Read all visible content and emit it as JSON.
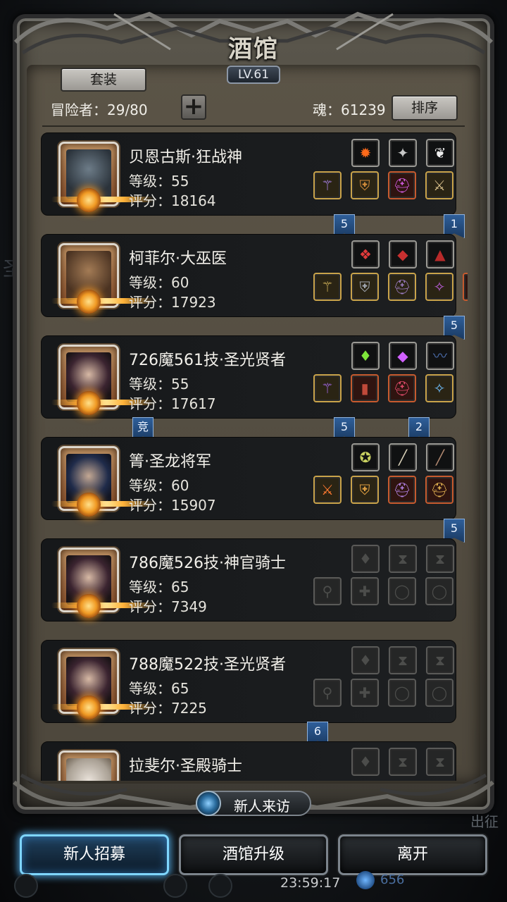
{
  "title": "酒馆",
  "level_badge": "LV.61",
  "header": {
    "suit_button": "套装",
    "adventurer_label": "冒险者：29/80",
    "add_button": "+",
    "soul_label": "魂：61239",
    "sort_button": "排序"
  },
  "heroes": [
    {
      "name": "贝恩古斯·狂战神",
      "level": "等级：55",
      "score": "评分：18164",
      "portrait": "berserker-portrait",
      "top_slots": [
        {
          "icon": "fire-orb",
          "glyph": "✹",
          "color": "#ff6a1a"
        },
        {
          "icon": "crest",
          "glyph": "✦",
          "color": "#c7c7c7"
        },
        {
          "icon": "wing",
          "glyph": "❦",
          "color": "#eeeeee"
        }
      ],
      "bottom_slots": [
        {
          "icon": "staff",
          "glyph": "⚚",
          "color": "#b58bff",
          "frame": "gold"
        },
        {
          "icon": "armor",
          "glyph": "⛨",
          "color": "#d08a3a",
          "frame": "gold"
        },
        {
          "icon": "helm",
          "glyph": "⛑",
          "color": "#d05adf",
          "frame": "red"
        },
        {
          "icon": "sword",
          "glyph": "⚔",
          "color": "#d8c08a",
          "frame": "gold"
        }
      ],
      "tags": [
        {
          "text": "5"
        },
        {
          "text": "1"
        }
      ]
    },
    {
      "name": "柯菲尔·大巫医",
      "level": "等级：60",
      "score": "评分：17923",
      "portrait": "shaman-portrait",
      "top_slots": [
        {
          "icon": "red-gem",
          "glyph": "❖",
          "color": "#e03a3a"
        },
        {
          "icon": "red-boot",
          "glyph": "◆",
          "color": "#c83030"
        },
        {
          "icon": "red-hat",
          "glyph": "▲",
          "color": "#b82a2a"
        }
      ],
      "bottom_slots": [
        {
          "icon": "gold-staff",
          "glyph": "⚚",
          "color": "#e0c060",
          "frame": "gold"
        },
        {
          "icon": "shield",
          "glyph": "⛨",
          "color": "#a0a6b0",
          "frame": "gold"
        },
        {
          "icon": "dark-helm",
          "glyph": "⛑",
          "color": "#9a7bc0",
          "frame": "gold"
        },
        {
          "icon": "amulet",
          "glyph": "✧",
          "color": "#c060e0",
          "frame": "gold"
        },
        {
          "icon": "crown",
          "glyph": "♛",
          "color": "#d85050",
          "frame": "red"
        }
      ],
      "tags": [
        {
          "text": "5"
        }
      ]
    },
    {
      "name": "726魔561技·圣光贤者",
      "level": "等级：55",
      "score": "评分：17617",
      "portrait": "sage-portrait",
      "top_slots": [
        {
          "icon": "green-crystal",
          "glyph": "♦",
          "color": "#7ee63a"
        },
        {
          "icon": "purple-crystal",
          "glyph": "◆",
          "color": "#d060ff"
        },
        {
          "icon": "dark-whip",
          "glyph": "〰",
          "color": "#4a6aa8"
        }
      ],
      "bottom_slots": [
        {
          "icon": "purple-staff",
          "glyph": "⚚",
          "color": "#b070ff",
          "frame": "gold"
        },
        {
          "icon": "cloak",
          "glyph": "▮",
          "color": "#c04a3a",
          "frame": "red"
        },
        {
          "icon": "helm",
          "glyph": "⛑",
          "color": "#e04a6a",
          "frame": "red"
        },
        {
          "icon": "pendant",
          "glyph": "✧",
          "color": "#70c0ff",
          "frame": "gold"
        }
      ],
      "tags": [
        {
          "text": "竞"
        },
        {
          "text": "5"
        },
        {
          "text": "2"
        }
      ]
    },
    {
      "name": "箐·圣龙将军",
      "level": "等级：60",
      "score": "评分：15907",
      "portrait": "general-portrait",
      "top_slots": [
        {
          "icon": "emblem",
          "glyph": "✪",
          "color": "#c8d060"
        },
        {
          "icon": "rod",
          "glyph": "╱",
          "color": "#d8d0b8"
        },
        {
          "icon": "blade",
          "glyph": "╱",
          "color": "#b08870"
        }
      ],
      "bottom_slots": [
        {
          "icon": "dragon-sword",
          "glyph": "⚔",
          "color": "#ff7a30",
          "frame": "gold"
        },
        {
          "icon": "gold-armor",
          "glyph": "⛨",
          "color": "#e0a040",
          "frame": "gold"
        },
        {
          "icon": "purple-helm",
          "glyph": "⛑",
          "color": "#b080e0",
          "frame": "red"
        },
        {
          "icon": "gold-helm",
          "glyph": "⛑",
          "color": "#e0b050",
          "frame": "red"
        }
      ],
      "tags": [
        {
          "text": "5"
        }
      ]
    },
    {
      "name": "786魔526技·神官骑士",
      "level": "等级：65",
      "score": "评分：7349",
      "portrait": "priest-portrait",
      "top_slots": [
        {
          "icon": "empty-drop",
          "glyph": "♦",
          "color": "#4c4d4b"
        },
        {
          "icon": "empty-hourglass",
          "glyph": "⧗",
          "color": "#4c4d4b"
        },
        {
          "icon": "empty-hourglass",
          "glyph": "⧗",
          "color": "#4c4d4b"
        }
      ],
      "bottom_slots": [
        {
          "icon": "empty-mace",
          "glyph": "⚲",
          "color": "#4c4d4b"
        },
        {
          "icon": "empty-armor",
          "glyph": "✚",
          "color": "#4c4d4b"
        },
        {
          "icon": "empty-ring",
          "glyph": "◯",
          "color": "#4c4d4b"
        },
        {
          "icon": "empty-ring",
          "glyph": "◯",
          "color": "#4c4d4b"
        }
      ],
      "tags": []
    },
    {
      "name": "788魔522技·圣光贤者",
      "level": "等级：65",
      "score": "评分：7225",
      "portrait": "sage-portrait",
      "top_slots": [
        {
          "icon": "empty-drop",
          "glyph": "♦",
          "color": "#4c4d4b"
        },
        {
          "icon": "empty-hourglass",
          "glyph": "⧗",
          "color": "#4c4d4b"
        },
        {
          "icon": "empty-hourglass",
          "glyph": "⧗",
          "color": "#4c4d4b"
        }
      ],
      "bottom_slots": [
        {
          "icon": "empty-mace",
          "glyph": "⚲",
          "color": "#4c4d4b"
        },
        {
          "icon": "empty-armor",
          "glyph": "✚",
          "color": "#4c4d4b"
        },
        {
          "icon": "empty-ring",
          "glyph": "◯",
          "color": "#4c4d4b"
        },
        {
          "icon": "empty-ring",
          "glyph": "◯",
          "color": "#4c4d4b"
        }
      ],
      "tags": [
        {
          "text": "6"
        }
      ]
    },
    {
      "name": "拉斐尔·圣殿骑士",
      "level": "",
      "score": "",
      "portrait": "knight-portrait",
      "top_slots": [
        {
          "icon": "empty-drop",
          "glyph": "♦",
          "color": "#4c4d4b"
        },
        {
          "icon": "empty-hourglass",
          "glyph": "⧗",
          "color": "#4c4d4b"
        },
        {
          "icon": "empty-hourglass",
          "glyph": "⧗",
          "color": "#4c4d4b"
        }
      ],
      "bottom_slots": [],
      "tags": []
    }
  ],
  "visitor_button": "新人来访",
  "bottom_buttons": {
    "recruit": "新人招募",
    "upgrade": "酒馆升级",
    "leave": "离开"
  },
  "footer": {
    "clock": "23:59:17",
    "soul": "656",
    "depart": "出征"
  }
}
